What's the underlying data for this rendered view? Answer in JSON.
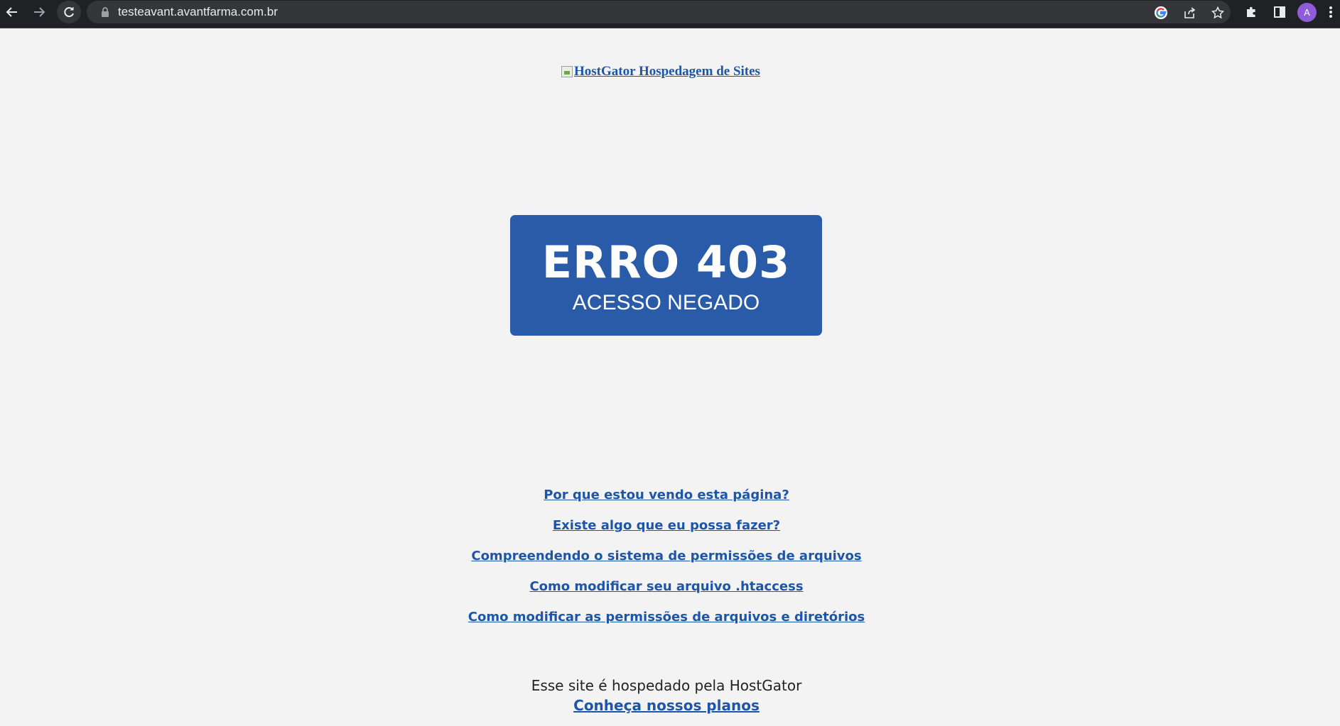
{
  "browser": {
    "url": "testeavant.avantfarma.com.br",
    "profile_initial": "A",
    "icons": [
      "back-icon",
      "forward-icon",
      "reload-icon",
      "lock-icon",
      "google-icon",
      "share-icon",
      "bookmark-star-icon",
      "extensions-icon",
      "side-panel-icon",
      "menu-icon"
    ]
  },
  "page": {
    "logo_alt": "HostGator Hospedagem de Sites",
    "error_title": "ERRO 403",
    "error_subtitle": "ACESSO NEGADO",
    "help_links": [
      "Por que estou vendo esta página?",
      "Existe algo que eu possa fazer?",
      "Compreendendo o sistema de permissões de arquivos",
      "Como modificar seu arquivo .htaccess",
      "Como modificar as permissões de arquivos e diretórios"
    ],
    "hosted_text": "Esse site é hospedado pela HostGator",
    "plans_link": "Conheça nossos planos"
  },
  "colors": {
    "page_background": "#f3f3f4",
    "error_box": "#2a5ba9",
    "link": "#1d56a8"
  }
}
